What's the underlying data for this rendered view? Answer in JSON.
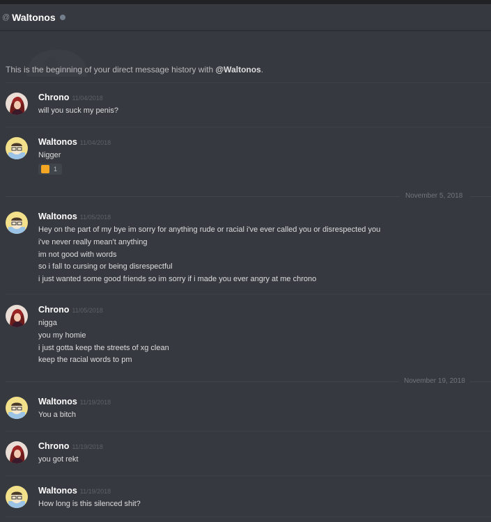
{
  "header": {
    "at_symbol": "@",
    "title": "Waltonos",
    "status_color": "#747f8d"
  },
  "intro": {
    "prefix": "This is the beginning of your direct message history with ",
    "mention": "@Waltonos",
    "suffix": "."
  },
  "date_separators": [
    "November 5, 2018",
    "November 19, 2018"
  ],
  "messages": [
    {
      "author": "Chrono",
      "timestamp": "11/04/2018",
      "avatar": "chrono-avatar",
      "lines": [
        "will you suck my penis?"
      ]
    },
    {
      "author": "Waltonos",
      "timestamp": "11/04/2018",
      "avatar": "waltonos-avatar",
      "lines": [
        "Nigger"
      ],
      "reaction": {
        "emoji": "emoji-icon",
        "count": "1"
      }
    },
    {
      "author": "Waltonos",
      "timestamp": "11/05/2018",
      "avatar": "waltonos-avatar",
      "lines": [
        "Hey on the part of my bye im sorry for anything rude or racial i've ever called you or disrespected you",
        "i've never really mean't anything",
        "im not good with words",
        "so i fall to cursing or being disrespectful",
        "i just wanted some good friends so im sorry if i made you ever angry at me chrono"
      ]
    },
    {
      "author": "Chrono",
      "timestamp": "11/05/2018",
      "avatar": "chrono-avatar",
      "lines": [
        "nigga",
        "you my homie",
        "i just gotta keep the streets of xg clean",
        "keep the racial words to pm"
      ]
    },
    {
      "author": "Waltonos",
      "timestamp": "11/19/2018",
      "avatar": "waltonos-avatar",
      "lines": [
        "You a bitch"
      ]
    },
    {
      "author": "Chrono",
      "timestamp": "11/19/2018",
      "avatar": "chrono-avatar",
      "lines": [
        "you got rekt"
      ]
    },
    {
      "author": "Waltonos",
      "timestamp": "11/19/2018",
      "avatar": "waltonos-avatar",
      "lines": [
        "How long is this silenced shit?"
      ]
    }
  ],
  "colors": {
    "background": "#36393f",
    "header_strip": "#202225",
    "text": "#dcddde",
    "muted": "#72767d"
  }
}
